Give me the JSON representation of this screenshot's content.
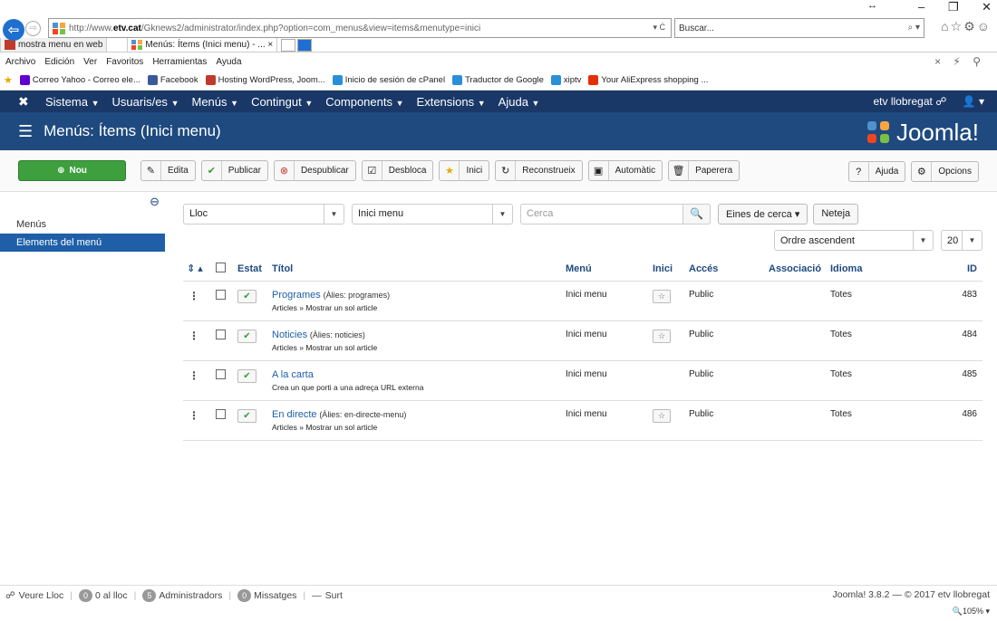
{
  "browser": {
    "url_prefix": "http://www.",
    "url_host": "etv.cat",
    "url_path": "/Gknews2/administrator/index.php?option=com_menus&view=items&menutype=inici",
    "url_controls": "▾ Ċ",
    "search_placeholder": "Buscar...",
    "tabs": [
      {
        "label": "mostra menu en web"
      },
      {
        "label": "Menús: Ítems (Inici menu) - ... ×"
      }
    ],
    "menu": [
      "Archivo",
      "Edición",
      "Ver",
      "Favoritos",
      "Herramientas",
      "Ayuda"
    ],
    "favorites": [
      {
        "label": "Correo Yahoo - Correo ele...",
        "color": "#5f01d1"
      },
      {
        "label": "Facebook",
        "color": "#3b5998"
      },
      {
        "label": "Hosting WordPress, Joom...",
        "color": "#c0392b"
      },
      {
        "label": "Inicio de sesión de cPanel",
        "color": "#2a8fd8"
      },
      {
        "label": "Traductor de Google",
        "color": "#2a8fd8"
      },
      {
        "label": "xiptv",
        "color": "#2a8fd8"
      },
      {
        "label": "Your AliExpress shopping ...",
        "color": "#e62e04"
      }
    ]
  },
  "joomla": {
    "nav": [
      {
        "label": "Sistema"
      },
      {
        "label": "Usuaris/es"
      },
      {
        "label": "Menús"
      },
      {
        "label": "Contingut"
      },
      {
        "label": "Components"
      },
      {
        "label": "Extensions"
      },
      {
        "label": "Ajuda"
      }
    ],
    "site_link": "etv llobregat ☍",
    "user_menu": "👤 ▾",
    "page_title": "Menús: Ítems (Inici menu)",
    "brand": "Joomla!",
    "toolbar": {
      "new": "Nou",
      "edit": "Edita",
      "publish": "Publicar",
      "unpublish": "Despublicar",
      "unlock": "Desbloca",
      "home": "Inici",
      "rebuild": "Reconstrueix",
      "auto": "Automàtic",
      "trash": "Paperera",
      "help": "Ajuda",
      "options": "Opcions"
    },
    "sidebar": [
      {
        "label": "Menús"
      },
      {
        "label": "Elements del menú"
      }
    ],
    "filters": {
      "location": "Lloc",
      "menu": "Inici menu",
      "search_placeholder": "Cerca",
      "search_tools": "Eines de cerca ▾",
      "clear": "Neteja",
      "order": "Ordre ascendent",
      "limit": "20"
    },
    "columns": {
      "sort": "⇕ ▴",
      "status": "Estat",
      "title": "Títol",
      "menu": "Menú",
      "home": "Inici",
      "access": "Accés",
      "association": "Associació",
      "language": "Idioma",
      "id": "ID"
    },
    "rows": [
      {
        "title": "Programes",
        "alias": "(Àlies: programes)",
        "sub": "Articles » Mostrar un sol article",
        "menu": "Inici menu",
        "home": true,
        "access": "Public",
        "language": "Totes",
        "id": "483"
      },
      {
        "title": "Noticies",
        "alias": "(Àlies: noticies)",
        "sub": "Articles » Mostrar un sol article",
        "menu": "Inici menu",
        "home": true,
        "access": "Public",
        "language": "Totes",
        "id": "484"
      },
      {
        "title": "A la carta",
        "alias": "",
        "sub": "Crea un que porti a una adreça URL externa",
        "menu": "Inici menu",
        "home": false,
        "access": "Public",
        "language": "Totes",
        "id": "485"
      },
      {
        "title": "En directe",
        "alias": "(Àlies: en-directe-menu)",
        "sub": "Articles » Mostrar un sol article",
        "menu": "Inici menu",
        "home": true,
        "access": "Public",
        "language": "Totes",
        "id": "486"
      }
    ],
    "status": {
      "view_site": "Veure Lloc",
      "visitors_count": "0",
      "visitors_label": "0 al lloc",
      "admins_count": "5",
      "admins_label": "Administradors",
      "messages_count": "0",
      "messages_label": "Missatges",
      "logout": "Surt",
      "version": "Joomla! 3.8.2 — © 2017 etv llobregat"
    },
    "zoom": "🔍105% ▾"
  }
}
